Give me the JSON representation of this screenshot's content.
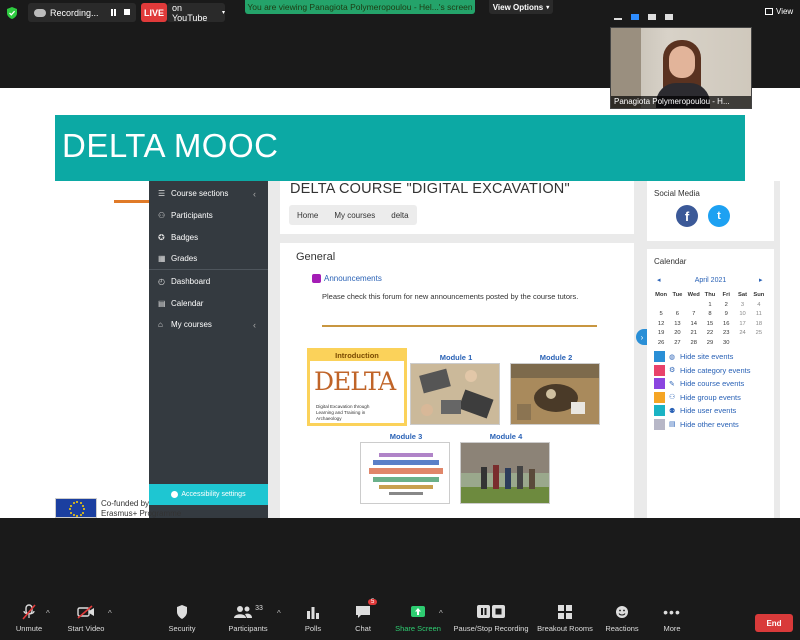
{
  "zoom": {
    "recording_label": "Recording...",
    "live_label": "LIVE",
    "youtube_label": "on YouTube",
    "viewing_banner": "You are viewing Panagiota Polymeropoulou - Hel...'s screen",
    "view_options": "View Options",
    "view_label": "View",
    "self_name": "Panagiota Polymeropoulou - H...",
    "toolbar": {
      "unmute": "Unmute",
      "start_video": "Start Video",
      "security": "Security",
      "participants": "Participants",
      "participants_count": "33",
      "polls": "Polls",
      "chat": "Chat",
      "chat_badge": "5",
      "share_screen": "Share Screen",
      "pause_recording": "Pause/Stop Recording",
      "breakout": "Breakout Rooms",
      "reactions": "Reactions",
      "more": "More",
      "end": "End"
    }
  },
  "slide": {
    "banner_title": "DELTA MOOC",
    "cofunded_line1": "Co-funded by",
    "cofunded_line2": "Erasmus+ Programme"
  },
  "moodle": {
    "sidebar": [
      {
        "label": "Course sections",
        "icon": "list-icon"
      },
      {
        "label": "Participants",
        "icon": "users-icon"
      },
      {
        "label": "Badges",
        "icon": "badge-icon"
      },
      {
        "label": "Grades",
        "icon": "table-icon"
      },
      {
        "label": "Dashboard",
        "icon": "dashboard-icon"
      },
      {
        "label": "Calendar",
        "icon": "calendar-icon"
      },
      {
        "label": "My courses",
        "icon": "graduation-cap-icon"
      }
    ],
    "accessibility": "Accessibility settings",
    "course_title": "DELTA COURSE \"DIGITAL EXCAVATION\"",
    "breadcrumb": [
      "Home",
      "My courses",
      "delta"
    ],
    "section_title": "General",
    "announcements": "Announcements",
    "announcement_text": "Please check this forum for new announcements posted by the course tutors.",
    "modules": [
      "Introduction",
      "Module 1",
      "Module 2",
      "Module 3",
      "Module 4"
    ],
    "intro_image": {
      "word": "DELTA",
      "subtitle": "Digital Excavation through Learning and Training in Archaeology"
    },
    "social_media_title": "Social Media",
    "calendar": {
      "title": "Calendar",
      "month": "April 2021",
      "days": [
        "Mon",
        "Tue",
        "Wed",
        "Thu",
        "Fri",
        "Sat",
        "Sun"
      ],
      "weeks": [
        [
          "",
          "",
          "",
          "1",
          "2",
          "3",
          "4"
        ],
        [
          "5",
          "6",
          "7",
          "8",
          "9",
          "10",
          "11"
        ],
        [
          "12",
          "13",
          "14",
          "15",
          "16",
          "17",
          "18"
        ],
        [
          "19",
          "20",
          "21",
          "22",
          "23",
          "24",
          "25"
        ],
        [
          "26",
          "27",
          "28",
          "29",
          "30",
          "",
          ""
        ]
      ],
      "events": [
        {
          "label": "Hide site events",
          "color": "#2a8fd6"
        },
        {
          "label": "Hide category events",
          "color": "#e8426b"
        },
        {
          "label": "Hide course events",
          "color": "#8b45e0"
        },
        {
          "label": "Hide group events",
          "color": "#f5a524"
        },
        {
          "label": "Hide user events",
          "color": "#1ab3c4"
        },
        {
          "label": "Hide other events",
          "color": "#b7b7c7"
        }
      ]
    }
  }
}
